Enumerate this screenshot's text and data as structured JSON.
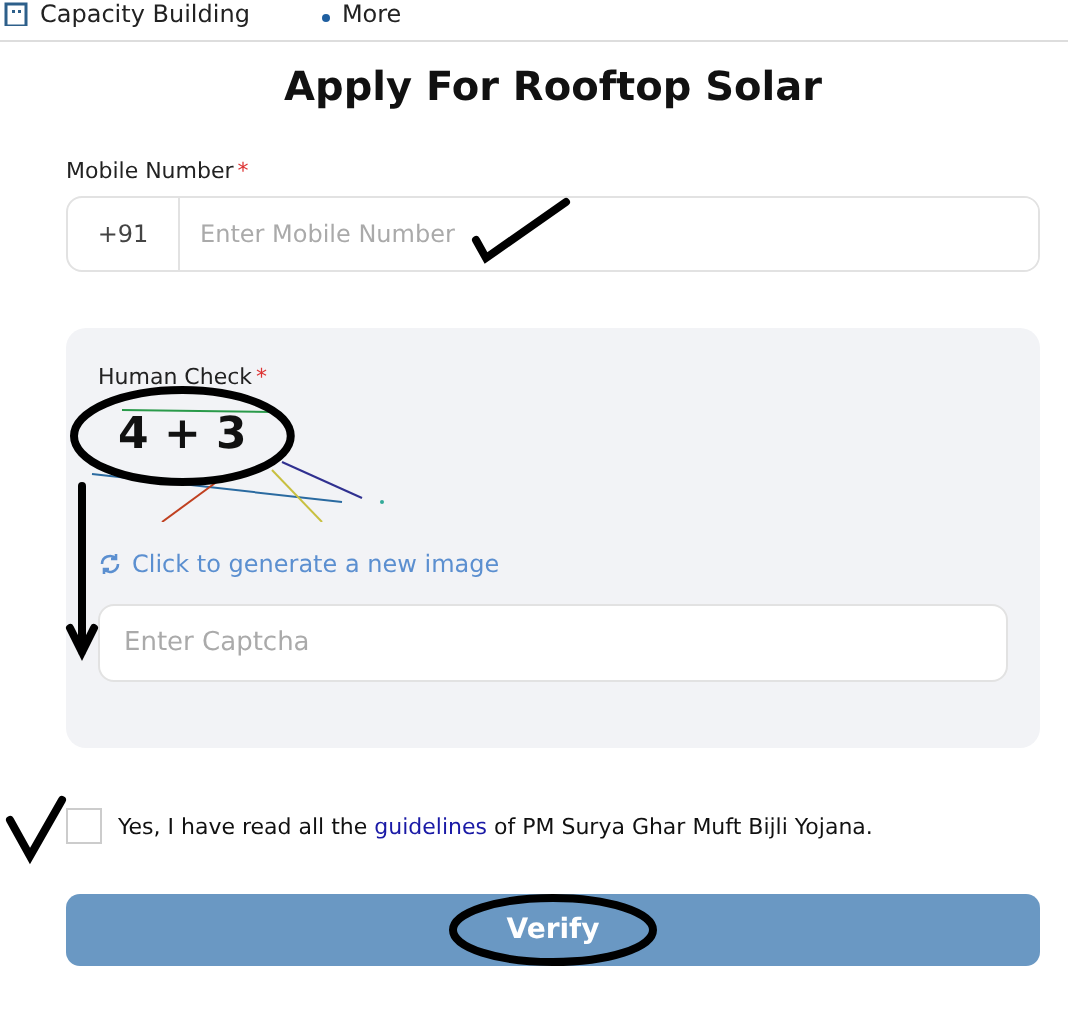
{
  "nav": {
    "items": [
      {
        "label": "Capacity Building",
        "kind": "building"
      },
      {
        "label": "More",
        "kind": "dots"
      }
    ]
  },
  "title": "Apply For Rooftop Solar",
  "mobile": {
    "label": "Mobile Number",
    "required_mark": "*",
    "prefix": "+91",
    "placeholder": "Enter Mobile Number"
  },
  "human_check": {
    "label": "Human Check",
    "required_mark": "*",
    "captcha_text": "4 + 3",
    "refresh_link": "Click to generate a new image",
    "placeholder": "Enter Captcha"
  },
  "agreement": {
    "checked": false,
    "text": "Yes, I have read all the",
    "link": "guidelines",
    "text_after": "of PM Surya Ghar Muft Bijli Yojana."
  },
  "button": "Verify"
}
